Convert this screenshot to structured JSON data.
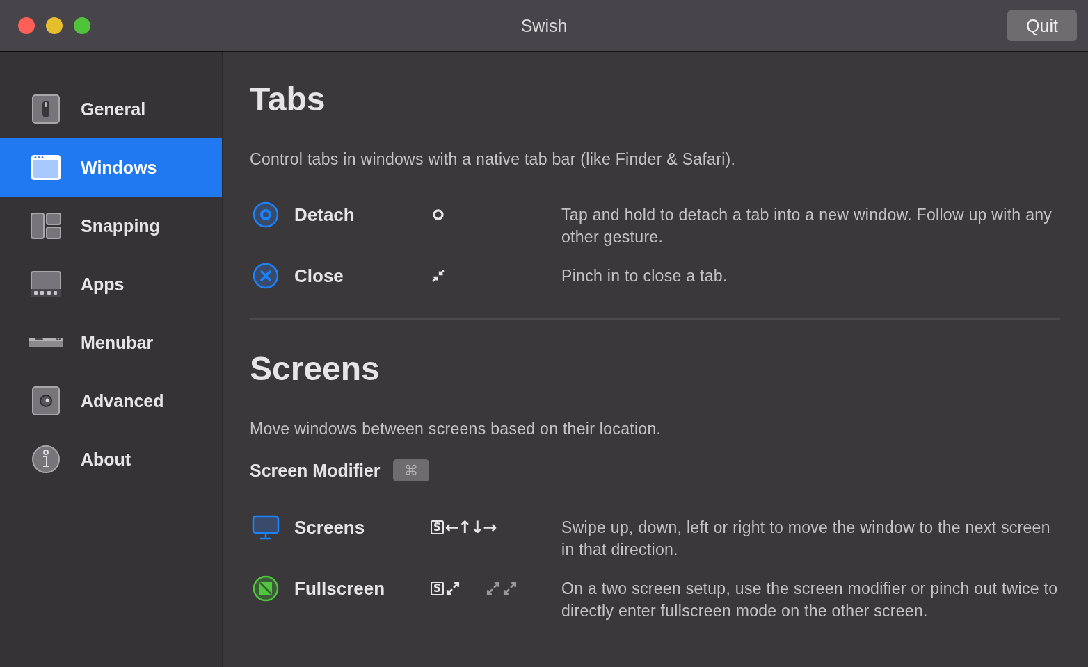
{
  "window": {
    "title": "Swish",
    "quit_button": "Quit"
  },
  "sidebar": {
    "items": [
      {
        "label": "General",
        "kind": "general",
        "selected": false
      },
      {
        "label": "Windows",
        "kind": "windows",
        "selected": true
      },
      {
        "label": "Snapping",
        "kind": "snapping",
        "selected": false
      },
      {
        "label": "Apps",
        "kind": "apps",
        "selected": false
      },
      {
        "label": "Menubar",
        "kind": "menubar",
        "selected": false
      },
      {
        "label": "Advanced",
        "kind": "advanced",
        "selected": false
      },
      {
        "label": "About",
        "kind": "about",
        "selected": false
      }
    ]
  },
  "sections": [
    {
      "title": "Tabs",
      "description": "Control tabs in windows with a native tab bar (like Finder & Safari).",
      "rows": [
        {
          "kind": "detach",
          "name": "Detach",
          "gestures": [
            {
              "kind": "tap"
            }
          ],
          "description": "Tap and hold to detach a tab into a new window. Follow up with any other gesture."
        },
        {
          "kind": "close",
          "name": "Close",
          "gestures": [
            {
              "kind": "pinch-in"
            }
          ],
          "description": "Pinch in to close a tab."
        }
      ]
    },
    {
      "title": "Screens",
      "description": "Move windows between screens based on their location.",
      "modifier": {
        "label": "Screen Modifier",
        "key": "⌘"
      },
      "rows": [
        {
          "kind": "screens",
          "name": "Screens",
          "gestures": [
            {
              "kind": "key",
              "label": "S"
            },
            {
              "kind": "text",
              "label": "←↑↓→"
            }
          ],
          "description": "Swipe up, down, left or right to move the window to the next screen in that direction."
        },
        {
          "kind": "fullscreen",
          "name": "Fullscreen",
          "gestures": [
            {
              "kind": "key",
              "label": "S"
            },
            {
              "kind": "pinch-out"
            }
          ],
          "secondary": [
            {
              "kind": "pinch-out"
            },
            {
              "kind": "pinch-out"
            }
          ],
          "description": "On a two screen setup, use the screen modifier or pinch out twice to directly enter fullscreen mode on the other screen."
        }
      ]
    }
  ]
}
